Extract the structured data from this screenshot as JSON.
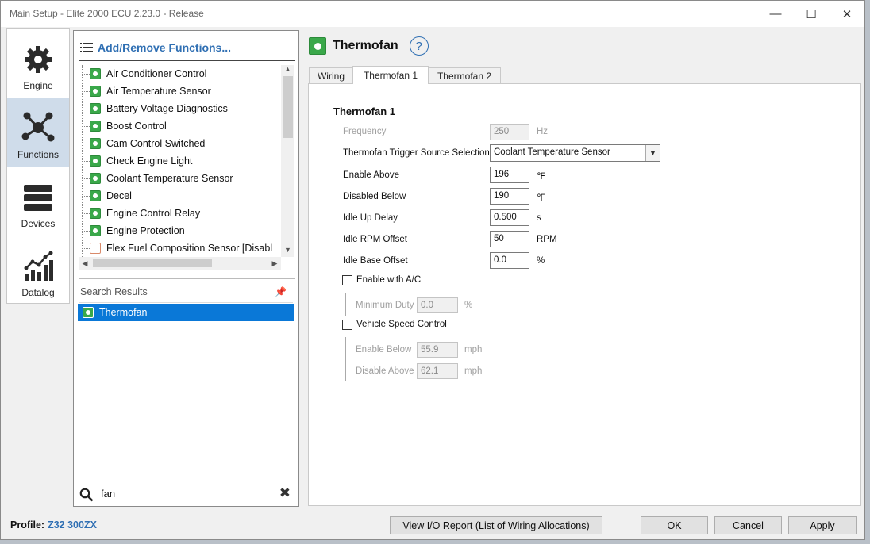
{
  "window": {
    "title": "Main Setup - Elite 2000 ECU 2.23.0 - Release",
    "min_glyph": "—",
    "max_glyph": "☐",
    "close_glyph": "✕"
  },
  "nav": {
    "items": [
      {
        "label": "Engine",
        "icon": "gear-icon"
      },
      {
        "label": "Functions",
        "icon": "network-icon",
        "active": true
      },
      {
        "label": "Devices",
        "icon": "server-icon"
      },
      {
        "label": "Datalog",
        "icon": "line-chart-icon"
      }
    ]
  },
  "functions": {
    "add_remove_label": "Add/Remove Functions...",
    "list": [
      {
        "label": "Air Conditioner Control",
        "enabled": true
      },
      {
        "label": "Air Temperature Sensor",
        "enabled": true
      },
      {
        "label": "Battery Voltage Diagnostics",
        "enabled": true
      },
      {
        "label": "Boost Control",
        "enabled": true
      },
      {
        "label": "Cam Control Switched",
        "enabled": true
      },
      {
        "label": "Check Engine Light",
        "enabled": true
      },
      {
        "label": "Coolant Temperature Sensor",
        "enabled": true
      },
      {
        "label": "Decel",
        "enabled": true
      },
      {
        "label": "Engine Control Relay",
        "enabled": true
      },
      {
        "label": "Engine Protection",
        "enabled": true
      },
      {
        "label": "Flex Fuel Composition Sensor [Disabl",
        "enabled": false
      }
    ],
    "search_results_label": "Search Results",
    "search_results": [
      {
        "label": "Thermofan"
      }
    ],
    "search_value": "fan"
  },
  "detail": {
    "title": "Thermofan",
    "help_glyph": "?",
    "tabs": [
      {
        "label": "Wiring"
      },
      {
        "label": "Thermofan 1",
        "active": true
      },
      {
        "label": "Thermofan 2"
      }
    ],
    "group_title": "Thermofan 1",
    "frequency": {
      "label": "Frequency",
      "value": "250",
      "unit": "Hz"
    },
    "trigger_source": {
      "label": "Thermofan Trigger Source Selection",
      "value": "Coolant Temperature Sensor"
    },
    "enable_above": {
      "label": "Enable Above",
      "value": "196",
      "unit": "℉"
    },
    "disabled_below": {
      "label": "Disabled Below",
      "value": "190",
      "unit": "℉"
    },
    "idle_up_delay": {
      "label": "Idle Up Delay",
      "value": "0.500",
      "unit": "s"
    },
    "idle_rpm_offset": {
      "label": "Idle RPM Offset",
      "value": "50",
      "unit": "RPM"
    },
    "idle_base_offset": {
      "label": "Idle Base Offset",
      "value": "0.0",
      "unit": "%"
    },
    "enable_ac": {
      "label": "Enable with A/C",
      "checked": false
    },
    "minimum_duty": {
      "label": "Minimum Duty",
      "value": "0.0",
      "unit": "%"
    },
    "vehicle_speed": {
      "label": "Vehicle Speed Control",
      "checked": false
    },
    "enable_below": {
      "label": "Enable Below",
      "value": "55.9",
      "unit": "mph"
    },
    "disable_above": {
      "label": "Disable Above",
      "value": "62.1",
      "unit": "mph"
    }
  },
  "footer": {
    "profile_label": "Profile:",
    "profile_value": "Z32 300ZX",
    "io_report_label": "View I/O Report (List of Wiring Allocations)",
    "ok_label": "OK",
    "cancel_label": "Cancel",
    "apply_label": "Apply"
  },
  "colors": {
    "accent": "#2f6fb3",
    "selection": "#0a78d7",
    "function_icon": "#3aa84a"
  }
}
